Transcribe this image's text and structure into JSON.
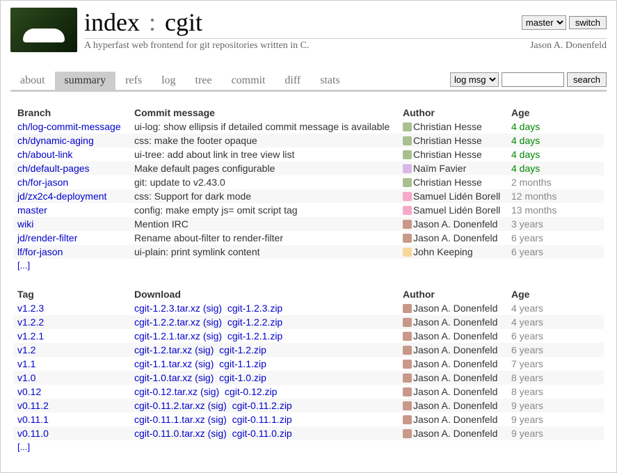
{
  "header": {
    "index_label": "index",
    "separator": ":",
    "repo": "cgit",
    "desc": "A hyperfast web frontend for git repositories written in C.",
    "owner": "Jason A. Donenfeld",
    "branch_select": "master",
    "switch_btn": "switch"
  },
  "tabs": {
    "items": [
      "about",
      "summary",
      "refs",
      "log",
      "tree",
      "commit",
      "diff",
      "stats"
    ],
    "active": "summary"
  },
  "search": {
    "type_select": "log msg",
    "btn": "search"
  },
  "branches_table": {
    "headers": {
      "branch": "Branch",
      "msg": "Commit message",
      "author": "Author",
      "age": "Age"
    },
    "rows": [
      {
        "branch": "ch/log-commit-message",
        "msg": "ui-log: show ellipsis if detailed commit message is available",
        "author": "Christian Hesse",
        "age": "4 days",
        "age_class": "age-green",
        "grav": "g1"
      },
      {
        "branch": "ch/dynamic-aging",
        "msg": "css: make the footer opaque",
        "author": "Christian Hesse",
        "age": "4 days",
        "age_class": "age-green",
        "grav": "g1"
      },
      {
        "branch": "ch/about-link",
        "msg": "ui-tree: add about link in tree view list",
        "author": "Christian Hesse",
        "age": "4 days",
        "age_class": "age-green",
        "grav": "g1"
      },
      {
        "branch": "ch/default-pages",
        "msg": "Make default pages configurable",
        "author": "Naïm Favier",
        "age": "4 days",
        "age_class": "age-green",
        "grav": "g2"
      },
      {
        "branch": "ch/for-jason",
        "msg": "git: update to v2.43.0",
        "author": "Christian Hesse",
        "age": "2 months",
        "age_class": "age-dim",
        "grav": "g1"
      },
      {
        "branch": "jd/zx2c4-deployment",
        "msg": "css: Support for dark mode",
        "author": "Samuel Lidén Borell",
        "age": "12 months",
        "age_class": "age-dim",
        "grav": "g3"
      },
      {
        "branch": "master",
        "msg": "config: make empty js= omit script tag",
        "author": "Samuel Lidén Borell",
        "age": "13 months",
        "age_class": "age-dim",
        "grav": "g3"
      },
      {
        "branch": "wiki",
        "msg": "Mention IRC",
        "author": "Jason A. Donenfeld",
        "age": "3 years",
        "age_class": "age-dim",
        "grav": "g4"
      },
      {
        "branch": "jd/render-filter",
        "msg": "Rename about-filter to render-filter",
        "author": "Jason A. Donenfeld",
        "age": "6 years",
        "age_class": "age-dim",
        "grav": "g4"
      },
      {
        "branch": "lf/for-jason",
        "msg": "ui-plain: print symlink content",
        "author": "John Keeping",
        "age": "6 years",
        "age_class": "age-dim",
        "grav": "g5"
      }
    ],
    "more": "[...]"
  },
  "tags_table": {
    "headers": {
      "tag": "Tag",
      "download": "Download",
      "author": "Author",
      "age": "Age"
    },
    "rows": [
      {
        "tag": "v1.2.3",
        "dl": [
          "cgit-1.2.3.tar.xz",
          "(sig)",
          "cgit-1.2.3.zip"
        ],
        "author": "Jason A. Donenfeld",
        "age": "4 years",
        "grav": "g4"
      },
      {
        "tag": "v1.2.2",
        "dl": [
          "cgit-1.2.2.tar.xz",
          "(sig)",
          "cgit-1.2.2.zip"
        ],
        "author": "Jason A. Donenfeld",
        "age": "4 years",
        "grav": "g4"
      },
      {
        "tag": "v1.2.1",
        "dl": [
          "cgit-1.2.1.tar.xz",
          "(sig)",
          "cgit-1.2.1.zip"
        ],
        "author": "Jason A. Donenfeld",
        "age": "6 years",
        "grav": "g4"
      },
      {
        "tag": "v1.2",
        "dl": [
          "cgit-1.2.tar.xz",
          "(sig)",
          "cgit-1.2.zip"
        ],
        "author": "Jason A. Donenfeld",
        "age": "6 years",
        "grav": "g4"
      },
      {
        "tag": "v1.1",
        "dl": [
          "cgit-1.1.tar.xz",
          "(sig)",
          "cgit-1.1.zip"
        ],
        "author": "Jason A. Donenfeld",
        "age": "7 years",
        "grav": "g4"
      },
      {
        "tag": "v1.0",
        "dl": [
          "cgit-1.0.tar.xz",
          "(sig)",
          "cgit-1.0.zip"
        ],
        "author": "Jason A. Donenfeld",
        "age": "8 years",
        "grav": "g4"
      },
      {
        "tag": "v0.12",
        "dl": [
          "cgit-0.12.tar.xz",
          "(sig)",
          "cgit-0.12.zip"
        ],
        "author": "Jason A. Donenfeld",
        "age": "8 years",
        "grav": "g4"
      },
      {
        "tag": "v0.11.2",
        "dl": [
          "cgit-0.11.2.tar.xz",
          "(sig)",
          "cgit-0.11.2.zip"
        ],
        "author": "Jason A. Donenfeld",
        "age": "9 years",
        "grav": "g4"
      },
      {
        "tag": "v0.11.1",
        "dl": [
          "cgit-0.11.1.tar.xz",
          "(sig)",
          "cgit-0.11.1.zip"
        ],
        "author": "Jason A. Donenfeld",
        "age": "9 years",
        "grav": "g4"
      },
      {
        "tag": "v0.11.0",
        "dl": [
          "cgit-0.11.0.tar.xz",
          "(sig)",
          "cgit-0.11.0.zip"
        ],
        "author": "Jason A. Donenfeld",
        "age": "9 years",
        "grav": "g4"
      }
    ],
    "more": "[...]"
  }
}
